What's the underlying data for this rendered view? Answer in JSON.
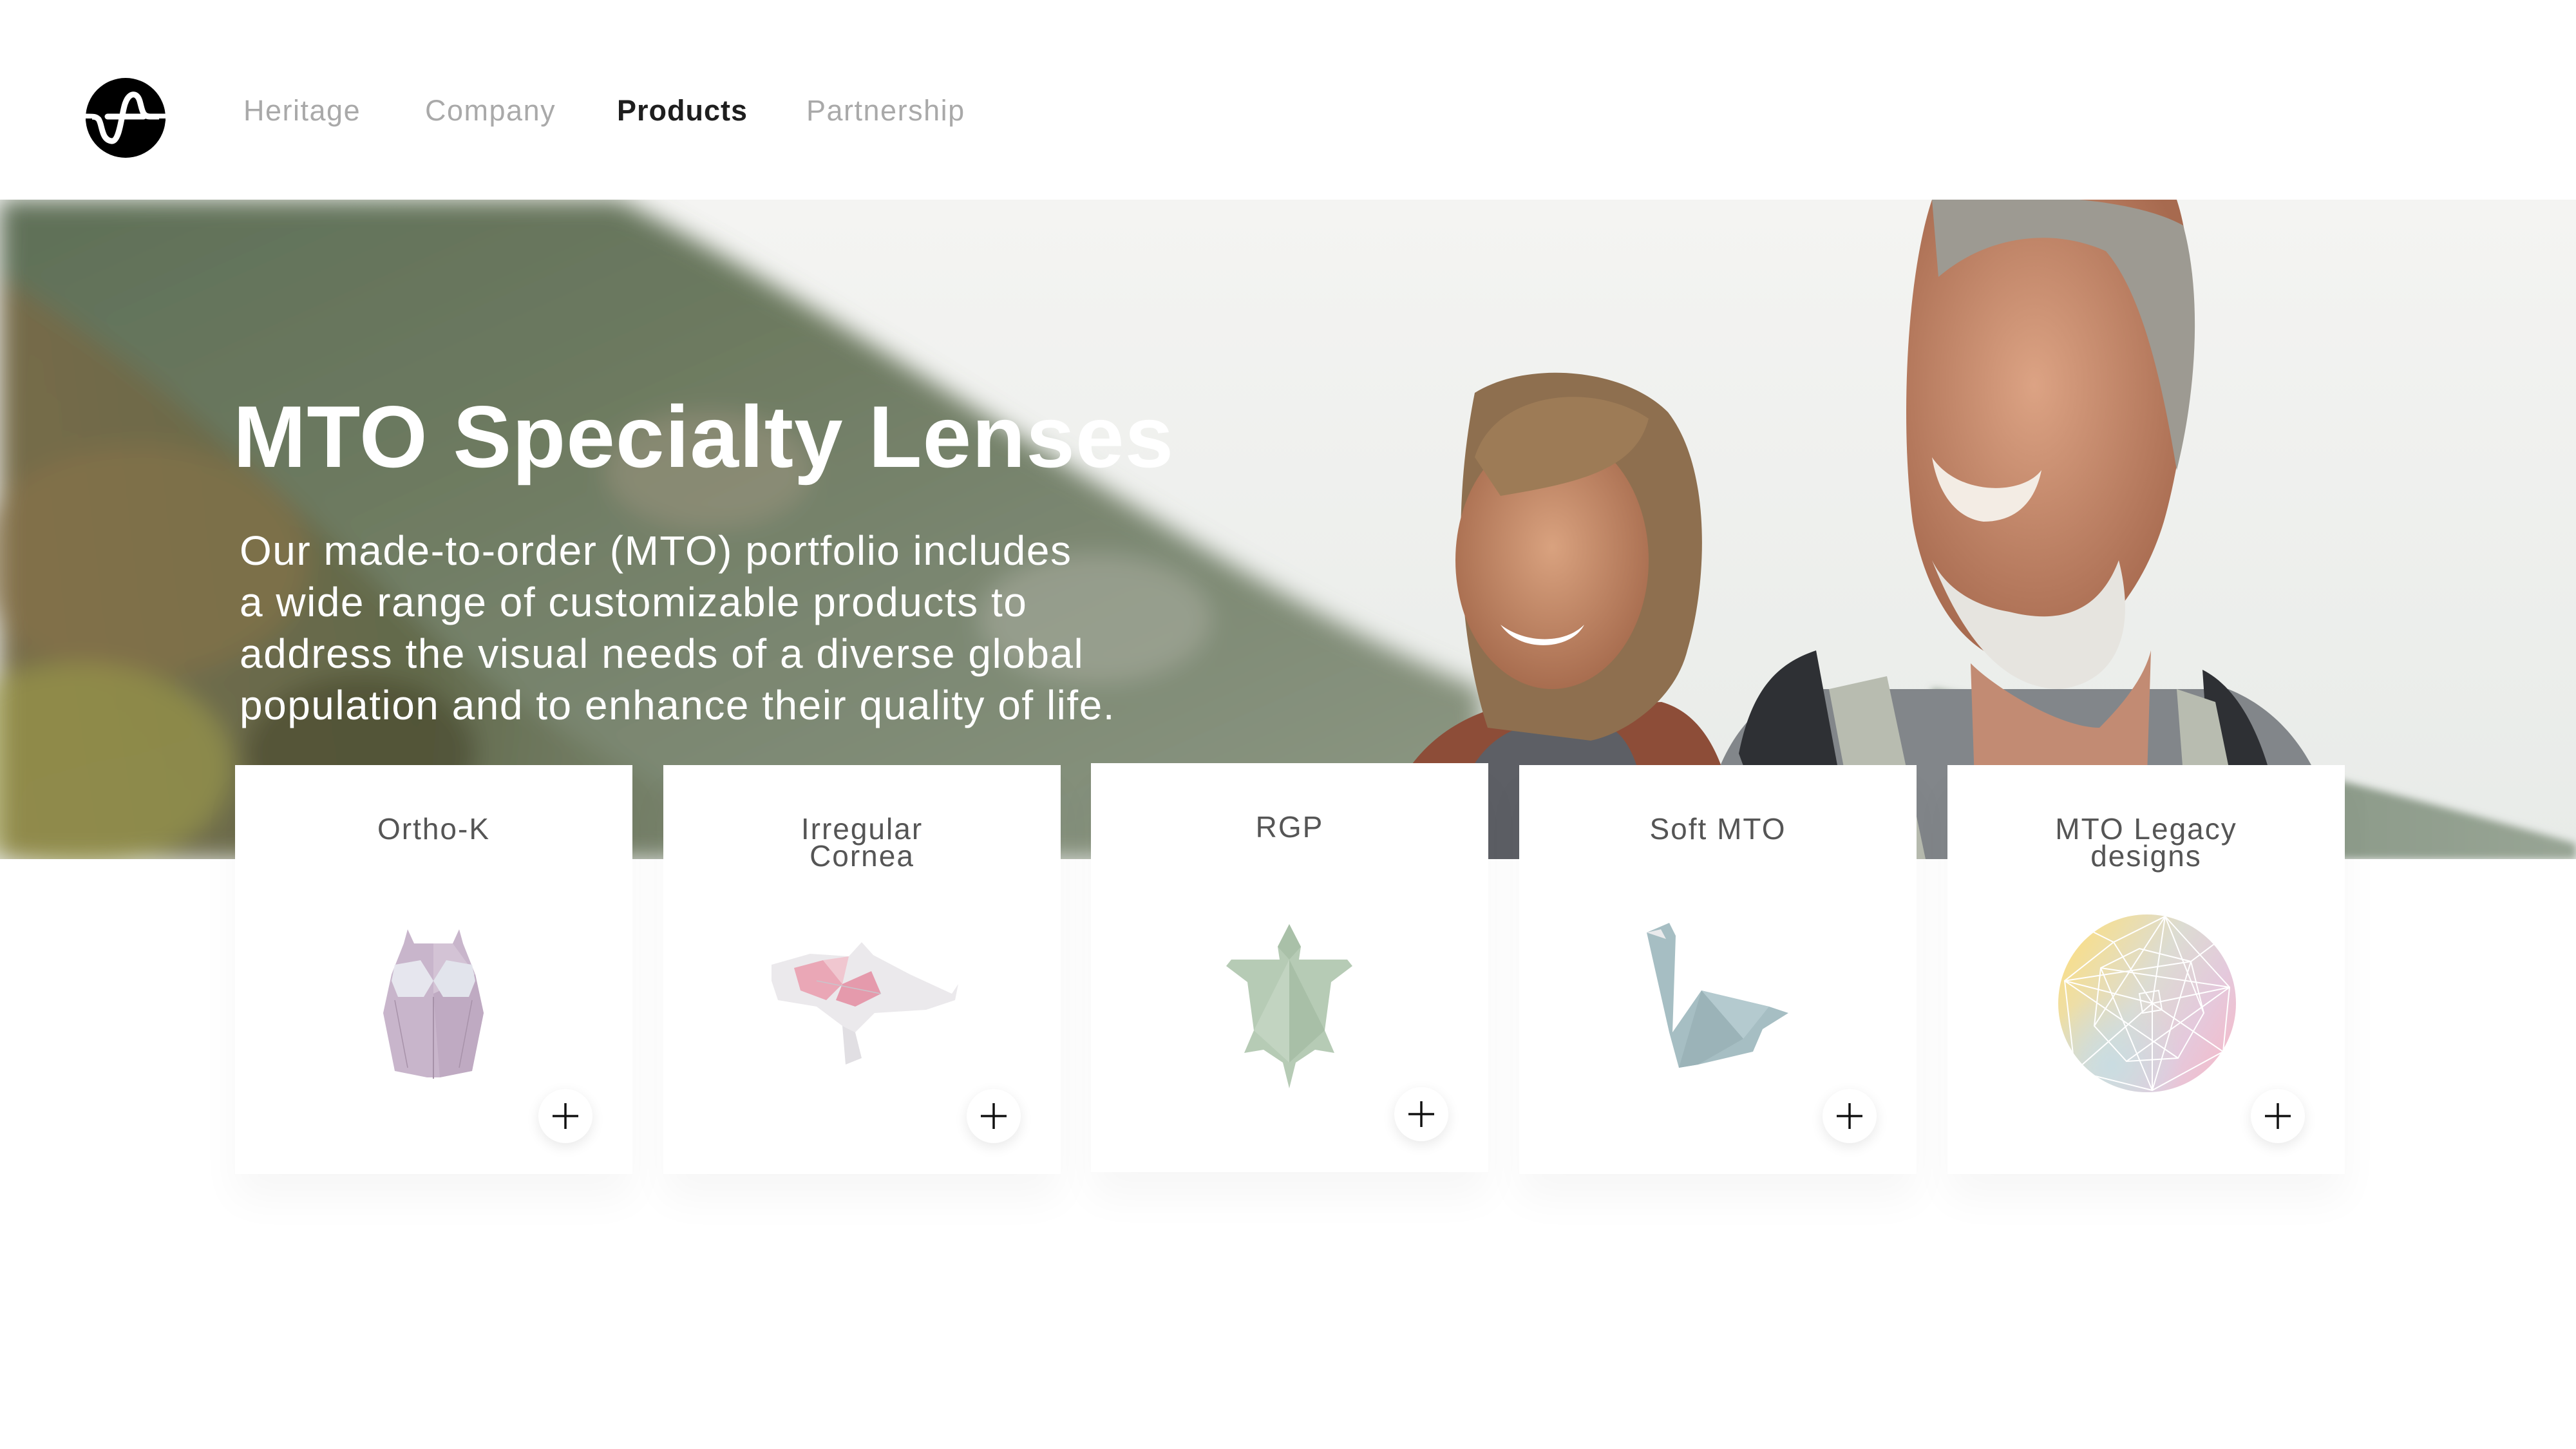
{
  "header": {
    "logo_icon": "wave-circle-logo-icon",
    "nav": [
      {
        "label": "Heritage",
        "active": false
      },
      {
        "label": "Company",
        "active": false
      },
      {
        "label": "Products",
        "active": true
      },
      {
        "label": "Partnership",
        "active": false
      }
    ]
  },
  "hero": {
    "title": "MTO Specialty Lenses",
    "body_lines": [
      "Our made-to-order (MTO) portfolio includes",
      "a wide range of customizable products to",
      "address the visual needs of a diverse global",
      "population and to enhance their quality of life."
    ],
    "image": "couple-hiking-mountain-photo"
  },
  "products": [
    {
      "title_lines": [
        "Ortho-K"
      ],
      "art": "origami-owl-icon",
      "color": "#c9b6cc",
      "action_icon": "plus-icon"
    },
    {
      "title_lines": [
        "Irregular",
        "Cornea"
      ],
      "art": "origami-koi-fish-icon",
      "color": "#e8a3b3",
      "action_icon": "plus-icon"
    },
    {
      "title_lines": [
        "RGP"
      ],
      "art": "origami-turtle-icon",
      "color": "#b9cdb8",
      "action_icon": "plus-icon"
    },
    {
      "title_lines": [
        "Soft MTO"
      ],
      "art": "origami-swan-icon",
      "color": "#a7bfc4",
      "action_icon": "plus-icon"
    },
    {
      "title_lines": [
        "MTO Legacy",
        "designs"
      ],
      "art": "geometric-lens-pattern-icon",
      "colors": [
        "#fbe08a",
        "#d7e0dd",
        "#f2bfce",
        "#cfd8e3"
      ],
      "action_icon": "plus-icon"
    }
  ],
  "colors": {
    "nav_inactive": "#a9a9a9",
    "nav_active": "#1e1e1e",
    "card_title": "#555555",
    "hero_text": "#ffffff"
  }
}
